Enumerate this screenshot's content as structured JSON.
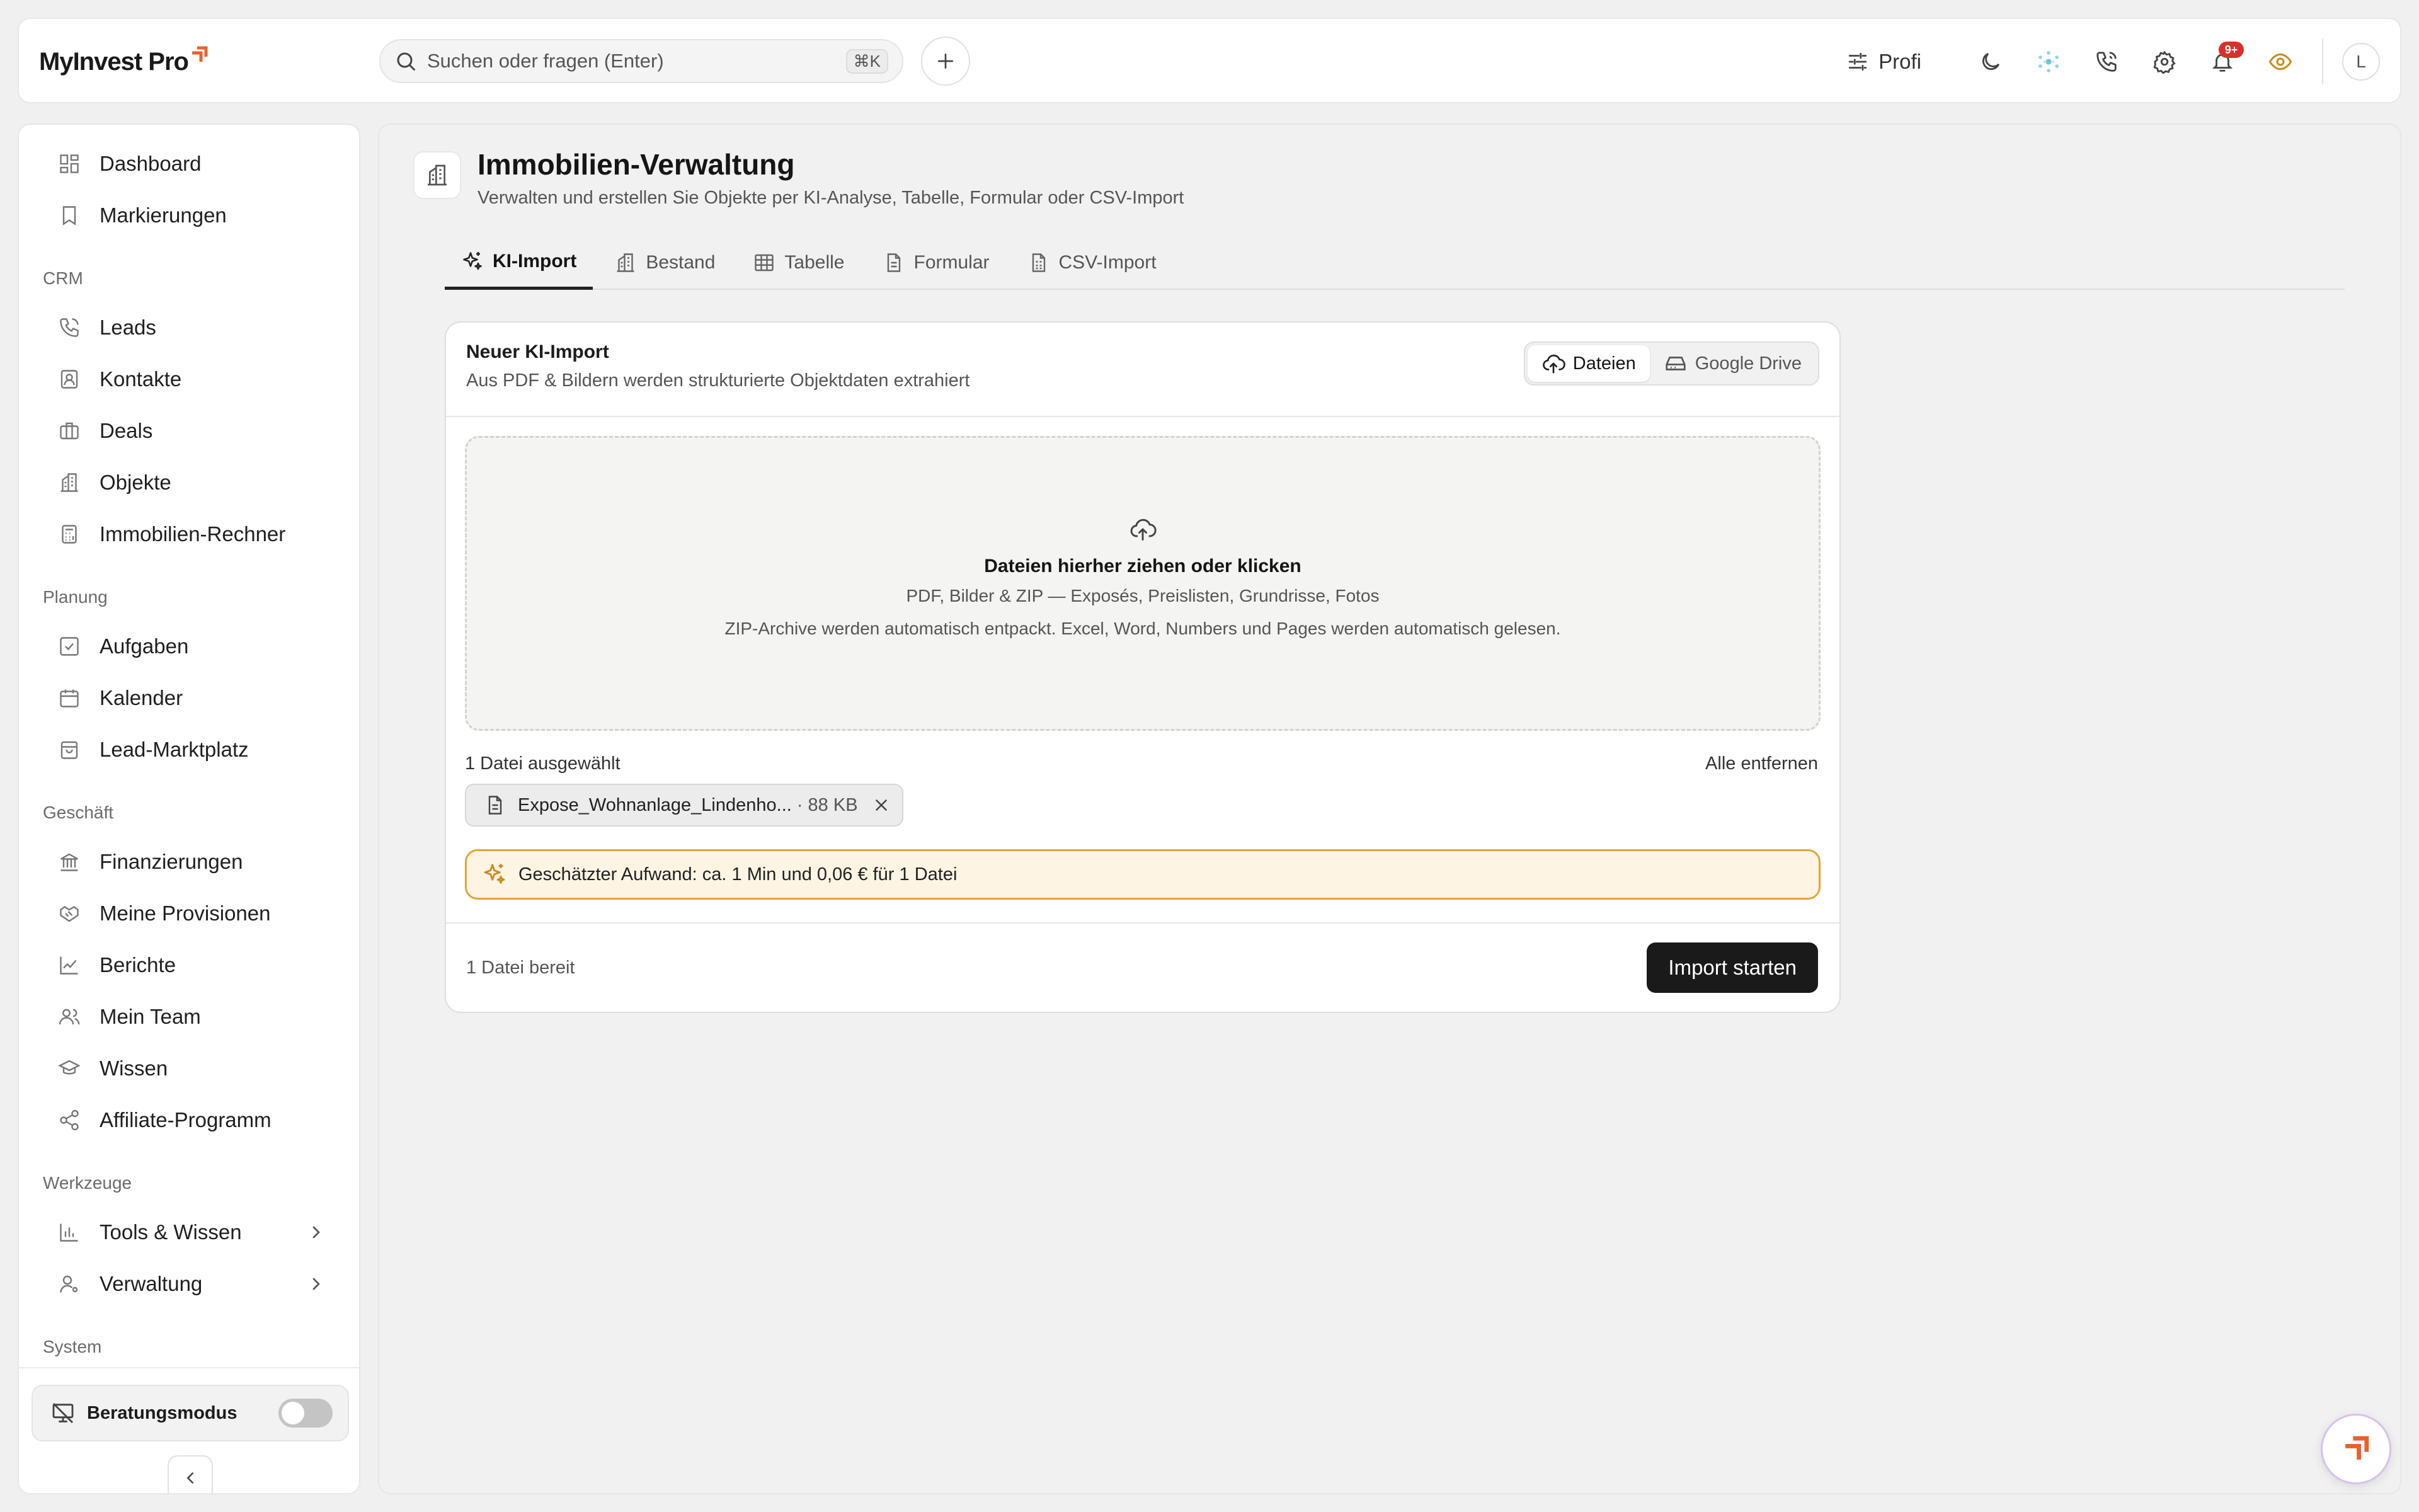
{
  "app": {
    "logo_text": "MyInvest Pro",
    "brand_accent": "#e8622c"
  },
  "topbar": {
    "search_placeholder": "Suchen oder fragen (Enter)",
    "search_shortcut": "⌘K",
    "mode_label": "Profi",
    "notification_badge": "9+",
    "avatar_initial": "L",
    "icons": [
      "sliders-icon",
      "moon-icon",
      "ai-sparkle-icon",
      "phone-icon",
      "gear-icon",
      "bell-icon",
      "eye-icon"
    ]
  },
  "sidebar": {
    "top_items": [
      {
        "label": "Dashboard",
        "icon": "dashboard-icon"
      },
      {
        "label": "Markierungen",
        "icon": "bookmark-icon"
      }
    ],
    "sections": [
      {
        "title": "CRM",
        "items": [
          {
            "label": "Leads",
            "icon": "phone-icon"
          },
          {
            "label": "Kontakte",
            "icon": "contact-icon"
          },
          {
            "label": "Deals",
            "icon": "briefcase-icon"
          },
          {
            "label": "Objekte",
            "icon": "building-icon"
          },
          {
            "label": "Immobilien-Rechner",
            "icon": "calculator-icon"
          }
        ]
      },
      {
        "title": "Planung",
        "items": [
          {
            "label": "Aufgaben",
            "icon": "checkbox-icon"
          },
          {
            "label": "Kalender",
            "icon": "calendar-icon"
          },
          {
            "label": "Lead-Marktplatz",
            "icon": "shopping-bag-icon"
          }
        ]
      },
      {
        "title": "Geschäft",
        "items": [
          {
            "label": "Finanzierungen",
            "icon": "bank-icon"
          },
          {
            "label": "Meine Provisionen",
            "icon": "handshake-icon"
          },
          {
            "label": "Berichte",
            "icon": "chart-line-icon"
          },
          {
            "label": "Mein Team",
            "icon": "users-icon"
          },
          {
            "label": "Wissen",
            "icon": "graduation-cap-icon"
          },
          {
            "label": "Affiliate-Programm",
            "icon": "share-icon"
          }
        ]
      },
      {
        "title": "Werkzeuge",
        "items": [
          {
            "label": "Tools & Wissen",
            "icon": "bar-chart-icon"
          },
          {
            "label": "Verwaltung",
            "icon": "user-cog-icon"
          }
        ]
      },
      {
        "title": "System",
        "items": []
      }
    ],
    "consult_mode": {
      "label": "Beratungsmodus",
      "enabled": false
    }
  },
  "page": {
    "title": "Immobilien-Verwaltung",
    "subtitle": "Verwalten und erstellen Sie Objekte per KI-Analyse, Tabelle, Formular oder CSV-Import",
    "tabs": [
      {
        "label": "KI-Import",
        "active": true
      },
      {
        "label": "Bestand",
        "active": false
      },
      {
        "label": "Tabelle",
        "active": false
      },
      {
        "label": "Formular",
        "active": false
      },
      {
        "label": "CSV-Import",
        "active": false
      }
    ]
  },
  "import_card": {
    "title": "Neuer KI-Import",
    "description": "Aus PDF & Bildern werden strukturierte Objektdaten extrahiert",
    "source_files": "Dateien",
    "source_drive": "Google Drive",
    "dropzone_title": "Dateien hierher ziehen oder klicken",
    "dropzone_formats": "PDF, Bilder & ZIP — Exposés, Preislisten, Grundrisse, Fotos",
    "dropzone_note": "ZIP-Archive werden automatisch entpackt. Excel, Word, Numbers und Pages werden automatisch gelesen.",
    "files_selected": "1 Datei ausgewählt",
    "remove_all": "Alle entfernen",
    "file_name": "Expose_Wohnanlage_Lindenho...",
    "file_size": "· 88 KB",
    "estimate_text": "Geschätzter Aufwand: ca. 1 Min und 0,06 € für 1 Datei",
    "ready_text": "1 Datei bereit",
    "start_button": "Import starten"
  }
}
